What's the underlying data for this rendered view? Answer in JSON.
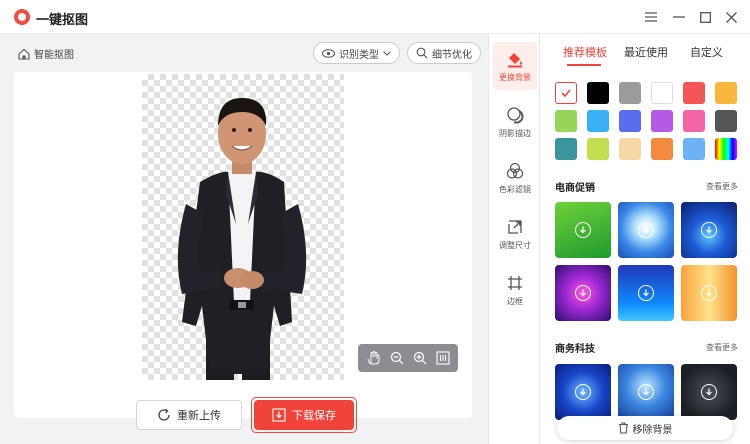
{
  "app": {
    "title": "一键抠图"
  },
  "toolbar": {
    "breadcrumb": "智能抠图",
    "detect_type": "识别类型",
    "refine": "细节优化"
  },
  "actions": {
    "reupload": "重新上传",
    "save": "下载保存"
  },
  "tools": [
    {
      "label": "更换背景",
      "icon": "paint-bucket-icon",
      "active": true
    },
    {
      "label": "阴影描边",
      "icon": "shadow-icon",
      "active": false
    },
    {
      "label": "色彩滤镜",
      "icon": "color-filter-icon",
      "active": false
    },
    {
      "label": "调整尺寸",
      "icon": "resize-icon",
      "active": false
    },
    {
      "label": "边框",
      "icon": "border-icon",
      "active": false
    }
  ],
  "panel": {
    "tabs": [
      "推荐模板",
      "最近使用",
      "自定义"
    ],
    "active_tab": 0,
    "colors": [
      "selected",
      "#000000",
      "#9b9b9b",
      "#ffffff",
      "#f25656",
      "#f8b73c",
      "#95d65a",
      "#3ab0f5",
      "#5a6df0",
      "#b55ae5",
      "#f563a8",
      "#555555",
      "#3a959e",
      "#c4de52",
      "#f7d7a6",
      "#f38a3f",
      "#6cb2f5",
      "rainbow"
    ],
    "sections": [
      {
        "title": "电商促销",
        "more": "查看更多"
      },
      {
        "title": "商务科技",
        "more": "查看更多"
      }
    ],
    "remove_bg": "移除背景"
  },
  "colors": {
    "accent": "#f0433b"
  }
}
